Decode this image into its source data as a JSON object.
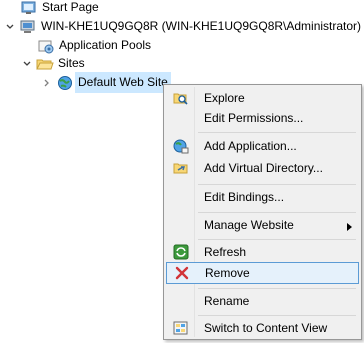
{
  "tree": {
    "start_page": "Start Page",
    "server": "WIN-KHE1UQ9GQ8R (WIN-KHE1UQ9GQ8R\\Administrator)",
    "app_pools": "Application Pools",
    "sites": "Sites",
    "default_site": "Default Web Site"
  },
  "menu": {
    "items": [
      {
        "label": "Explore",
        "icon": "explore-icon"
      },
      {
        "label": "Edit Permissions...",
        "icon": ""
      },
      {
        "label": "Add Application...",
        "icon": "add-application-icon"
      },
      {
        "label": "Add Virtual Directory...",
        "icon": "add-virtual-directory-icon"
      },
      {
        "label": "Edit Bindings...",
        "icon": ""
      },
      {
        "label": "Manage Website",
        "icon": "",
        "submenu": true
      },
      {
        "label": "Refresh",
        "icon": "refresh-icon"
      },
      {
        "label": "Remove",
        "icon": "remove-icon",
        "highlighted": true
      },
      {
        "label": "Rename",
        "icon": ""
      },
      {
        "label": "Switch to Content View",
        "icon": "content-view-icon"
      }
    ]
  },
  "colors": {
    "selection": "#cce8ff",
    "menu_bg": "#f0f0f0",
    "highlight_border": "#5b9bd5",
    "remove_x": "#d13438"
  }
}
